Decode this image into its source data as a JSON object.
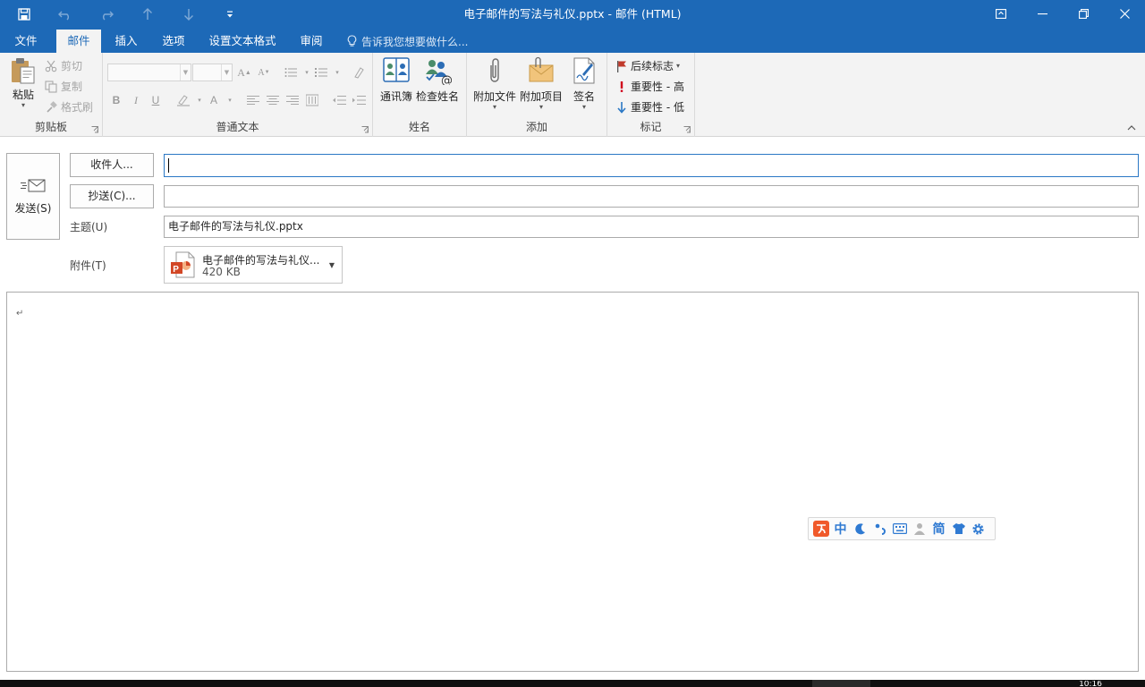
{
  "window": {
    "title": "电子邮件的写法与礼仪.pptx - 邮件 (HTML)"
  },
  "tabs": [
    {
      "label": "文件",
      "active": false
    },
    {
      "label": "邮件",
      "active": true
    },
    {
      "label": "插入",
      "active": false
    },
    {
      "label": "选项",
      "active": false
    },
    {
      "label": "设置文本格式",
      "active": false
    },
    {
      "label": "审阅",
      "active": false
    }
  ],
  "tell_me": {
    "placeholder": "告诉我您想要做什么..."
  },
  "ribbon": {
    "clipboard": {
      "label": "剪贴板",
      "paste": "粘贴",
      "cut": "剪切",
      "copy": "复制",
      "format_painter": "格式刷"
    },
    "basic_text": {
      "label": "普通文本"
    },
    "names": {
      "label": "姓名",
      "address_book": "通讯簿",
      "check_names": "检查姓名"
    },
    "include": {
      "label": "添加",
      "attach_file": "附加文件",
      "attach_item": "附加项目",
      "signature": "签名"
    },
    "tags": {
      "label": "标记",
      "follow_up": "后续标志",
      "high_importance": "重要性 - 高",
      "low_importance": "重要性 - 低"
    }
  },
  "compose": {
    "send": "发送(S)",
    "to_button": "收件人...",
    "cc_button": "抄送(C)...",
    "to_value": "",
    "cc_value": "",
    "subject_label": "主题(U)",
    "subject_value": "电子邮件的写法与礼仪.pptx",
    "attachments_label": "附件(T)",
    "attachment": {
      "name": "电子邮件的写法与礼仪...",
      "size": "420 KB"
    },
    "body_mark": "↵"
  },
  "ime": {
    "mode": "中",
    "simplified": "简"
  },
  "taskbar": {
    "clock": "10:16"
  },
  "colors": {
    "accent": "#1d69b7",
    "ribbon_bg": "#f3f3f3",
    "flag": "#c0392b",
    "high": "#d0021b",
    "low": "#2b78c5"
  }
}
